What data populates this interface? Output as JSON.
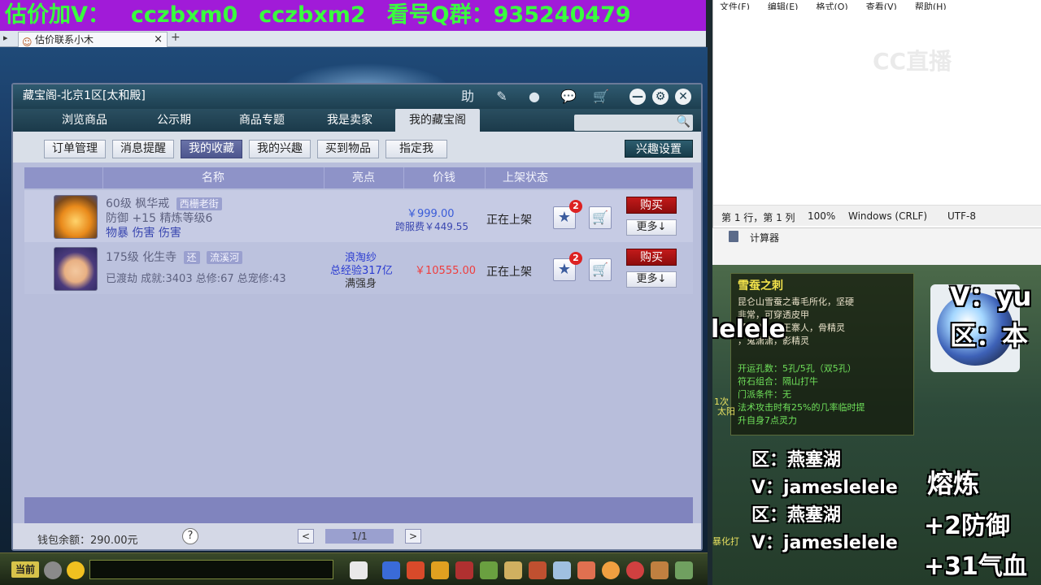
{
  "banner": {
    "items": [
      "估价加V：",
      "cczbxm0",
      "cczbxm2",
      "看号Q群：935240479"
    ]
  },
  "browser": {
    "nav": "▸",
    "tab_title": "估价联系小木",
    "tab_close": "×",
    "tab_add": "+"
  },
  "shop": {
    "title": "藏宝阁-北京1区[太和殿]",
    "title_icons": {
      "help": "助",
      "edit": "✎",
      "record": "●",
      "chat": "💬",
      "cart": "🛒"
    },
    "window_buttons": {
      "minimize": "—",
      "settings": "⚙",
      "close": "✕"
    },
    "nav_tabs": [
      "浏览商品",
      "公示期",
      "商品专题",
      "我是卖家",
      "我的藏宝阁"
    ],
    "active_nav": "我的藏宝阁",
    "sub_tabs": [
      "订单管理",
      "消息提醒",
      "我的收藏",
      "我的兴趣",
      "买到物品",
      "指定我"
    ],
    "active_sub": "我的收藏",
    "interest_button": "兴趣设置",
    "table_headers": {
      "name": "名称",
      "highlight": "亮点",
      "price": "价钱",
      "status": "上架状态"
    },
    "rows": [
      {
        "line1_level": "60级",
        "line1_name": "枫华戒",
        "line1_tag": "西栅老街",
        "line2": "防御 +15 精炼等级6",
        "line3": "物暴 伤害 伤害",
        "highlight_1": "",
        "highlight_2": "",
        "highlight_3": "",
        "price": "￥999.00",
        "fee": "跨服费￥449.55",
        "status": "正在上架",
        "star_count": "2",
        "star_icon": "★",
        "cart_icon": "🛒",
        "buy": "购买",
        "more": "更多↓"
      },
      {
        "line1_level": "175级",
        "line1_name": "化生寺",
        "line1_tag_small": "还",
        "line1_tag": "流溪河",
        "line2": "已渡劫 成就:3403 总修:67 总宠修:43",
        "highlight_1": "浪淘纱",
        "highlight_2": "总经验317亿",
        "highlight_3": "满强身",
        "price": "￥10555.00",
        "status": "正在上架",
        "star_count": "2",
        "star_icon": "★",
        "cart_icon": "🛒",
        "buy": "购买",
        "more": "更多↓"
      }
    ],
    "wallet": "钱包余额：290.00元",
    "help": "?",
    "page_prev": "<",
    "page_num": "1/1",
    "page_next": ">"
  },
  "gamebar": {
    "current_channel": "当前"
  },
  "notepad": {
    "menu": [
      "文件(F)",
      "编辑(E)",
      "格式(O)",
      "查看(V)",
      "帮助(H)"
    ],
    "status": {
      "position": "第 1 行，第 1 列",
      "zoom": "100%",
      "eol": "Windows (CRLF)",
      "encoding": "UTF-8"
    },
    "watermark": "CC直播"
  },
  "calculator": {
    "title": "计算器"
  },
  "stream": {
    "tooltip_title": "雪蚕之刺",
    "tooltip_lines": [
      "昆仑山雪蚕之毒毛所化，坚硬",
      "非常，可穿透皮甲",
      "【角色】魔王寨人，骨精灵",
      "，鬼潇潇，影精灵"
    ],
    "tooltip_green": [
      "开运孔数：5孔/5孔（双5孔）",
      "符石组合：隔山打牛",
      "门派条件：无",
      "法术攻击时有25%的几率临时提",
      "升自身7点灵力"
    ],
    "left_partial": "lelele",
    "left_extra": [
      "1次",
      "太阳"
    ],
    "overlay_left": [
      "区：燕塞湖",
      "V：jameslelele",
      "区：燕塞湖",
      "V：jameslelele"
    ],
    "overlay_right_top": [
      "V：yu",
      "区：本"
    ],
    "overlay_right_bottom": [
      "熔炼",
      "+2防御",
      "+31气血"
    ],
    "bottom_left": "暴化打"
  },
  "colors": {
    "banner_bg": "#a11bd8",
    "banner_text": "#39ff3e",
    "buy_red": "#c21a1a",
    "price_red": "#ef3d3d",
    "link_blue": "#2a3bd1"
  }
}
